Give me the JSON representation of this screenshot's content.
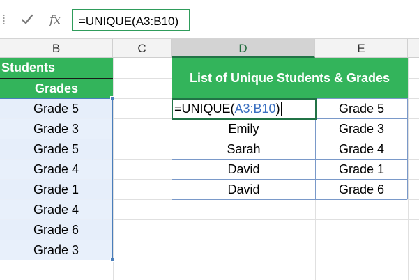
{
  "formula_bar": {
    "cancel_icon": "cross-icon",
    "confirm_icon": "checkmark-icon",
    "fx_label": "fx",
    "formula": "=UNIQUE(A3:B10)"
  },
  "columns": [
    "B",
    "C",
    "D",
    "E"
  ],
  "active_column": "D",
  "colors": {
    "header_green": "#33b45b",
    "active_border": "#217346",
    "range_blue": "#4a7ebb",
    "ref_blue": "#3a6fc0"
  },
  "sheet": {
    "b_title": "Students",
    "b_header": "Grades",
    "b_values": [
      "Grade 5",
      "Grade 3",
      "Grade 5",
      "Grade 4",
      "Grade 1",
      "Grade 4",
      "Grade 6",
      "Grade 3"
    ],
    "de_title": "List of Unique Students & Grades",
    "edit_cell": {
      "prefix": "=UNIQUE(",
      "ref": "A3:B10",
      "suffix": ")"
    },
    "de_rows": [
      {
        "d": "",
        "e": "Grade 5"
      },
      {
        "d": "Emily",
        "e": "Grade 3"
      },
      {
        "d": "Sarah",
        "e": "Grade 4"
      },
      {
        "d": "David",
        "e": "Grade 1"
      },
      {
        "d": "David",
        "e": "Grade 6"
      }
    ]
  }
}
